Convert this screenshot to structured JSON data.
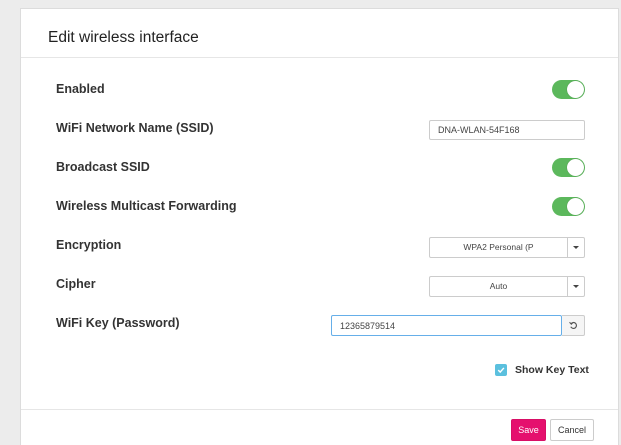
{
  "dialog": {
    "title": "Edit wireless interface"
  },
  "fields": {
    "enabled": {
      "label": "Enabled",
      "value": true
    },
    "ssid": {
      "label": "WiFi Network Name (SSID)",
      "value": "DNA-WLAN-54F168"
    },
    "broadcast_ssid": {
      "label": "Broadcast SSID",
      "value": true
    },
    "multicast_forwarding": {
      "label": "Wireless Multicast Forwarding",
      "value": true
    },
    "encryption": {
      "label": "Encryption",
      "selected": "WPA2 Personal (P"
    },
    "cipher": {
      "label": "Cipher",
      "selected": "Auto"
    },
    "wifi_key": {
      "label": "WiFi Key (Password)",
      "value": "12365879514"
    },
    "show_key_text": {
      "label": "Show Key Text",
      "checked": true
    }
  },
  "footer": {
    "save_label": "Save",
    "cancel_label": "Cancel"
  },
  "colors": {
    "toggle_on": "#5cb85c",
    "save_button": "#e5106e",
    "checkbox": "#5bc0de",
    "input_focus": "#66afe9"
  },
  "icons": {
    "select_arrow": "caret-down-icon",
    "reset": "reset-icon",
    "checkbox": "checkmark-icon"
  }
}
